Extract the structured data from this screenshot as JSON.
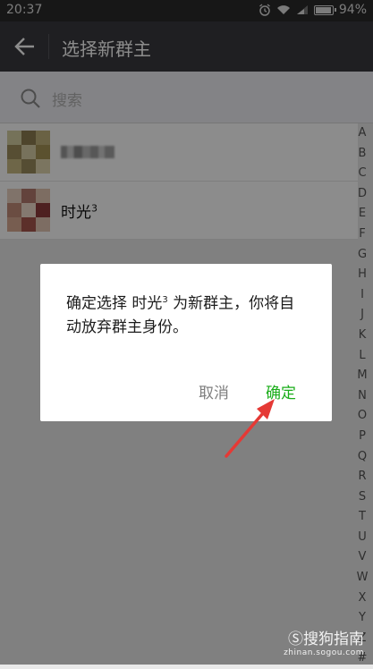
{
  "status_bar": {
    "time": "20:37",
    "battery": "94%",
    "battery_level": 0.94
  },
  "app_bar": {
    "title": "选择新群主"
  },
  "search": {
    "placeholder": "搜索"
  },
  "members": [
    {
      "name": ""
    },
    {
      "name": "时光",
      "superscript": "3"
    }
  ],
  "alphabet_index": [
    "A",
    "B",
    "C",
    "D",
    "E",
    "F",
    "G",
    "H",
    "I",
    "J",
    "K",
    "L",
    "M",
    "N",
    "O",
    "P",
    "Q",
    "R",
    "S",
    "T",
    "U",
    "V",
    "W",
    "X",
    "Y",
    "Z",
    "#"
  ],
  "dialog": {
    "message_part1": "确定选择 时光",
    "message_superscript": "3",
    "message_part2": " 为新群主，你将自动放弃群主身份。",
    "cancel": "取消",
    "confirm": "确定"
  },
  "watermark": {
    "brand": "搜狗指南",
    "url": "zhinan.sogou.com"
  },
  "colors": {
    "accent": "#1aad19",
    "app_bar": "#393a3f",
    "annotation_arrow": "#e53935"
  }
}
